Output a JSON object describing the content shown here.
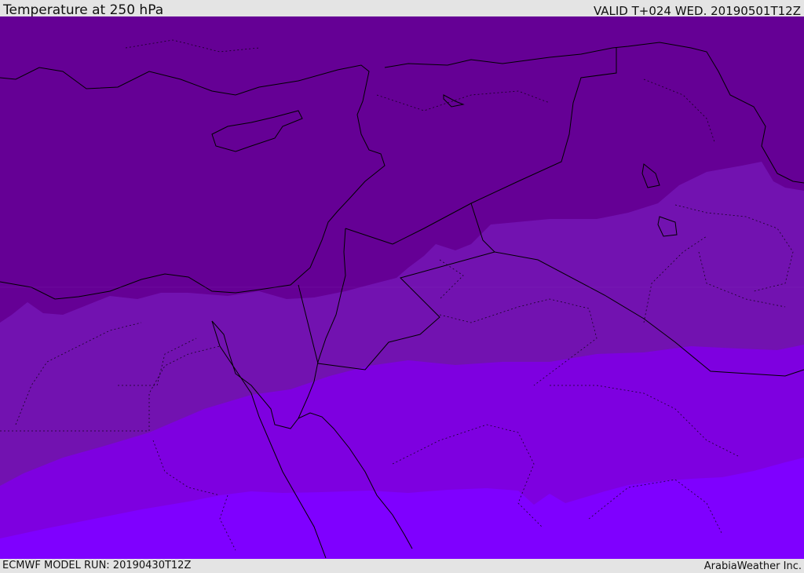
{
  "header": {
    "title": "Temperature at 250 hPa",
    "valid": "VALID T+024 WED. 20190501T12Z"
  },
  "footer": {
    "model_run": "ECMWF MODEL RUN: 20190430T12Z",
    "credit": "ArabiaWeather Inc."
  },
  "colors": {
    "band_coldest": "#650095",
    "band_2": "#7212b0",
    "band_3": "#7e00e0",
    "band_warmest": "#7f00ff",
    "coastline": "#000000",
    "header_bg": "#e4e4e4"
  }
}
